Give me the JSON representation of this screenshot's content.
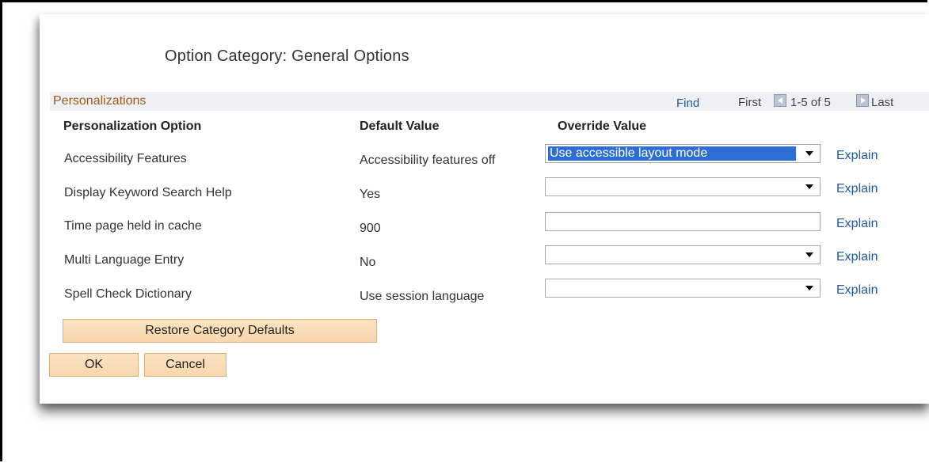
{
  "title": "Option Category:  General Options",
  "section": {
    "title": "Personalizations",
    "find_label": "Find",
    "first_label": "First",
    "count_label": "1-5 of 5",
    "last_label": "Last"
  },
  "columns": {
    "option": "Personalization Option",
    "default": "Default Value",
    "override": "Override Value"
  },
  "rows": [
    {
      "option": "Accessibility Features",
      "default": "Accessibility features off",
      "override": "Use accessible layout mode",
      "control": "select",
      "explain": "Explain"
    },
    {
      "option": "Display Keyword Search Help",
      "default": "Yes",
      "override": "",
      "control": "select",
      "explain": "Explain"
    },
    {
      "option": "Time page held in cache",
      "default": "900",
      "override": "",
      "control": "text",
      "explain": "Explain"
    },
    {
      "option": "Multi Language Entry",
      "default": "No",
      "override": "",
      "control": "select",
      "explain": "Explain"
    },
    {
      "option": "Spell Check Dictionary",
      "default": "Use session language",
      "override": "",
      "control": "select",
      "explain": "Explain"
    }
  ],
  "buttons": {
    "restore": "Restore Category Defaults",
    "ok": "OK",
    "cancel": "Cancel"
  },
  "colors": {
    "accent_link": "#1e5aa0",
    "section_title": "#9a5b1f",
    "button_bg": "#f7d7ad",
    "selection": "#2d6ed6"
  }
}
